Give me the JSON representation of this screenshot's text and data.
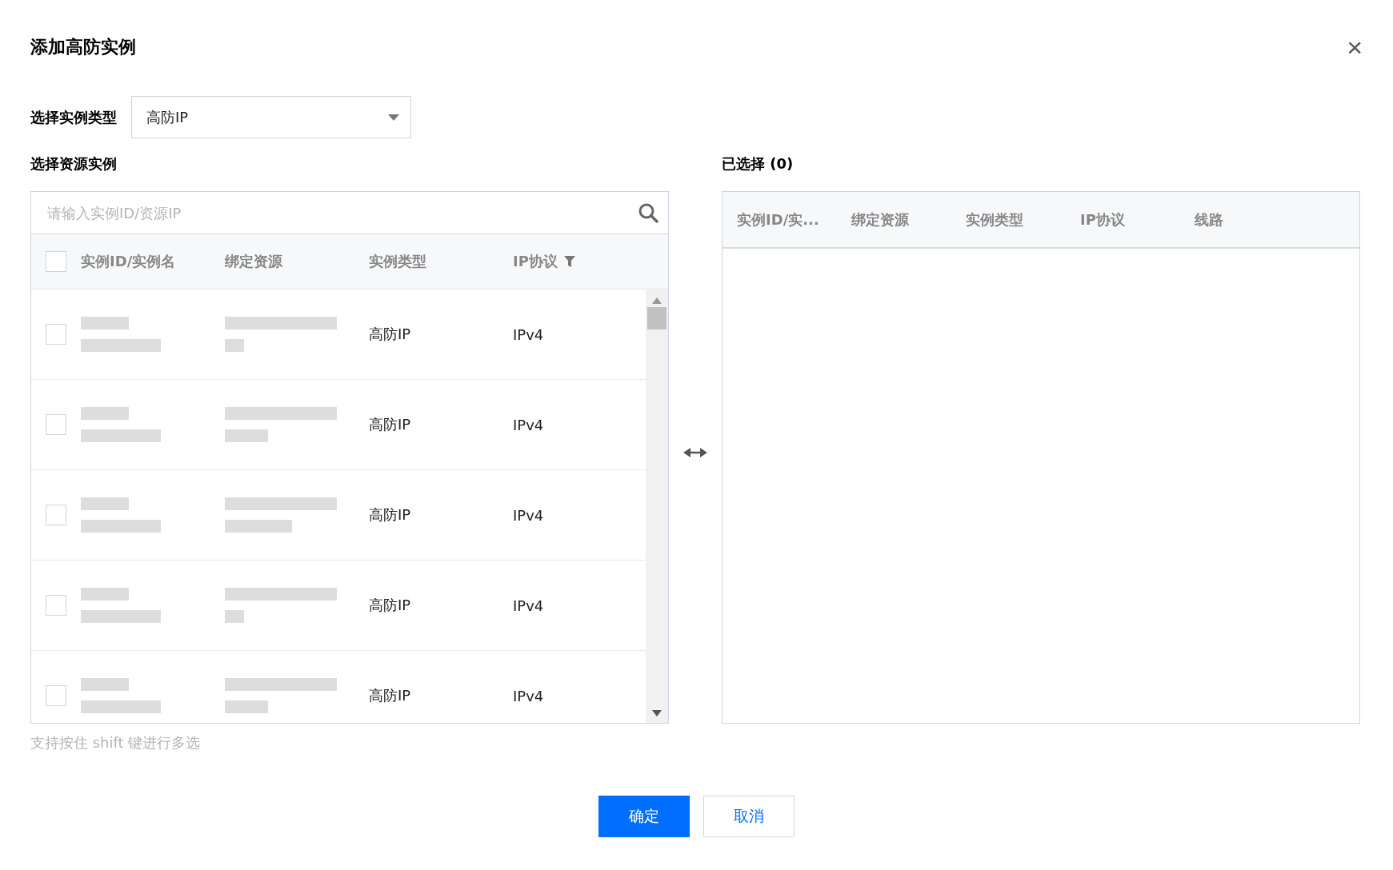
{
  "dialog": {
    "title": "添加高防实例",
    "close": "×"
  },
  "instance_type": {
    "label": "选择实例类型",
    "value": "高防IP"
  },
  "source": {
    "label": "选择资源实例",
    "search": {
      "placeholder": "请输入实例ID/资源IP"
    },
    "columns": [
      {
        "label": "实例ID/实例名",
        "filter": false
      },
      {
        "label": "绑定资源",
        "filter": false
      },
      {
        "label": "实例类型",
        "filter": false
      },
      {
        "label": "IP协议",
        "filter": true
      }
    ],
    "select_all": {
      "checked": false
    },
    "rows": [
      {
        "checked": false,
        "type": "高防IP",
        "protocol": "IPv4"
      },
      {
        "checked": false,
        "type": "高防IP",
        "protocol": "IPv4"
      },
      {
        "checked": false,
        "type": "高防IP",
        "protocol": "IPv4"
      },
      {
        "checked": false,
        "type": "高防IP",
        "protocol": "IPv4"
      },
      {
        "checked": false,
        "type": "高防IP",
        "protocol": "IPv4"
      }
    ],
    "hint": "支持按住 shift 键进行多选"
  },
  "selected": {
    "title": "已选择 (0)",
    "columns": [
      "实例ID/实...",
      "绑定资源",
      "实例类型",
      "IP协议",
      "线路"
    ]
  },
  "buttons": [
    {
      "label": "确定",
      "kind": "primary"
    },
    {
      "label": "取消",
      "kind": "secondary"
    }
  ]
}
